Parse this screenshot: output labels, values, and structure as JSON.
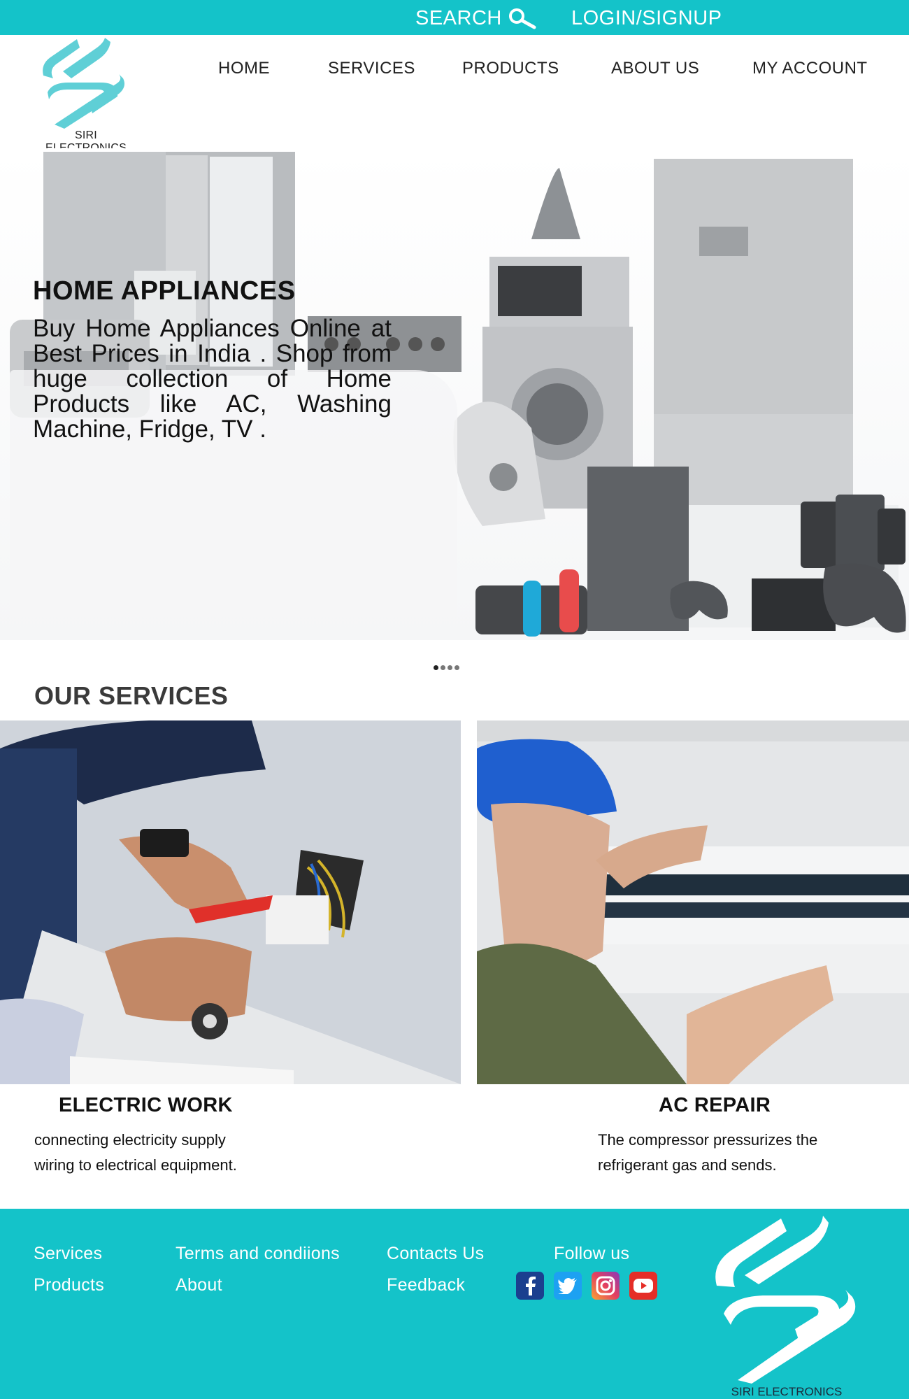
{
  "topbar": {
    "search_label": "SEARCH",
    "login_label": "LOGIN/SIGNUP"
  },
  "brand": {
    "name": "SIRI ELECTRONICS",
    "logo_icon": "siri-s-logo-icon"
  },
  "nav": {
    "items": [
      {
        "label": "HOME"
      },
      {
        "label": "SERVICES"
      },
      {
        "label": "PRODUCTS"
      },
      {
        "label": "ABOUT US"
      },
      {
        "label": "MY ACCOUNT"
      }
    ]
  },
  "hero": {
    "title": "HOME APPLIANCES",
    "description": "Buy Home Appliances Online at Best Prices in India . Shop from huge collection of Home Products like AC, Washing Machine, Fridge, TV .",
    "slide_count": 4,
    "active_slide": 1
  },
  "services": {
    "heading": "OUR SERVICES",
    "cards": [
      {
        "title": "ELECTRIC WORK",
        "desc_line1": "connecting electricity supply",
        "desc_line2": "wiring to electrical equipment."
      },
      {
        "title": "AC REPAIR",
        "desc_line1": "The compressor pressurizes the",
        "desc_line2": "refrigerant gas and sends."
      }
    ]
  },
  "footer": {
    "col1": [
      "Services",
      "Products"
    ],
    "col2": [
      "Terms and condiions",
      "About"
    ],
    "col3": [
      "Contacts Us",
      "Feedback"
    ],
    "follow_label": "Follow us",
    "social": [
      "facebook-icon",
      "twitter-icon",
      "instagram-icon",
      "youtube-icon"
    ],
    "brand_name": "SIRI ELECTRONICS"
  },
  "colors": {
    "accent": "#14c3c9",
    "logo": "#5fcfd6",
    "facebook": "#1877f2",
    "twitter": "#1da1f2",
    "youtube": "#e52d27"
  }
}
